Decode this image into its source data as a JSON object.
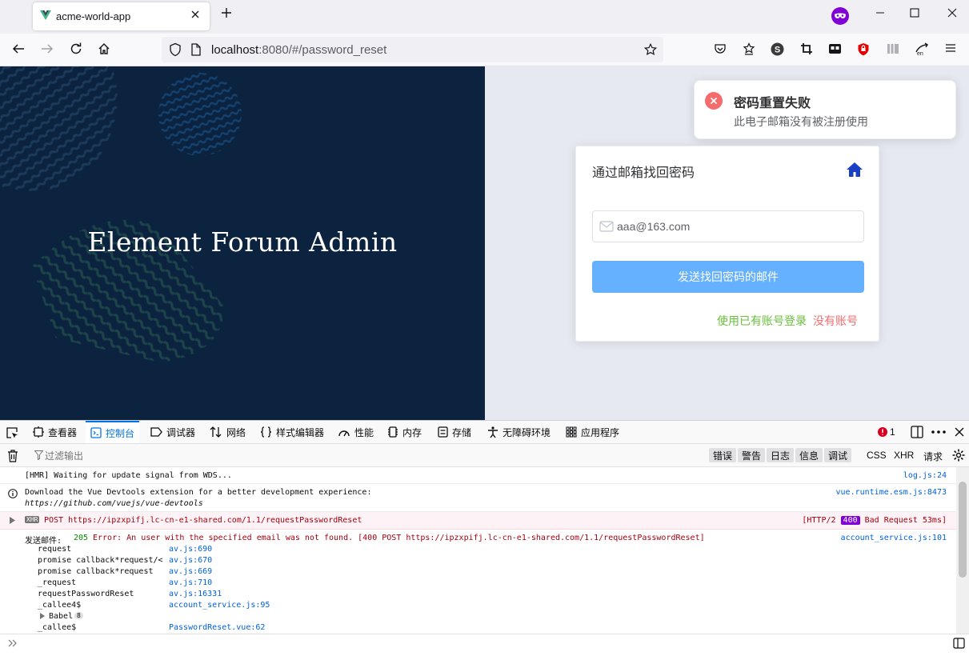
{
  "browser": {
    "tab_title": "acme-world-app",
    "url_host": "localhost",
    "url_rest": ":8080/#/password_reset"
  },
  "hero": {
    "title": "Element Forum Admin",
    "background": "#0c2340"
  },
  "card": {
    "title": "通过邮箱找回密码",
    "email_value": "aaa@163.com",
    "send_button": "发送找回密码的邮件",
    "login_link": "使用已有账号登录",
    "register_link": "没有账号"
  },
  "toast": {
    "title": "密码重置失败",
    "message": "此电子邮箱没有被注册使用"
  },
  "devtools": {
    "tabs": [
      "查看器",
      "控制台",
      "调试器",
      "网络",
      "样式编辑器",
      "性能",
      "内存",
      "存储",
      "无障碍环境",
      "应用程序"
    ],
    "active_tab": "控制台",
    "error_count": "1",
    "filter_placeholder": "过滤输出",
    "levels": [
      "错误",
      "警告",
      "日志",
      "信息",
      "调试"
    ],
    "filters": [
      "CSS",
      "XHR",
      "请求"
    ],
    "console": {
      "hmr": {
        "text": "[HMR] Waiting for update signal from WDS...",
        "src": "log.js:24"
      },
      "vue_info": {
        "line1": "Download the Vue Devtools extension for a better development experience:",
        "line2": "https://github.com/vuejs/vue-devtools",
        "src": "vue.runtime.esm.js:8473"
      },
      "xhr": {
        "badge": "XHR",
        "text": "POST https://ipzxpifj.lc-cn-e1-shared.com/1.1/requestPasswordReset",
        "status_pre": "[HTTP/2",
        "status_code": "400",
        "status_post": "Bad Request 53ms]"
      },
      "error": {
        "label": "发送邮件:",
        "code": "205",
        "text": "Error: An user with the specified email was not found. [400 POST https://ipzxpifj.lc-cn-e1-shared.com/1.1/requestPasswordReset]",
        "src": "account_service.js:101"
      },
      "trace": [
        {
          "fn": "request",
          "loc": "av.js:690"
        },
        {
          "fn": "promise callback*request/<",
          "loc": "av.js:670"
        },
        {
          "fn": "promise callback*request",
          "loc": "av.js:669"
        },
        {
          "fn": "_request",
          "loc": "av.js:710"
        },
        {
          "fn": "requestPasswordReset",
          "loc": "av.js:16331"
        },
        {
          "fn": "_callee4$",
          "loc": "account_service.js:95"
        },
        {
          "fn": "Babel",
          "loc": "8"
        },
        {
          "fn": "_callee$",
          "loc": "PasswordReset.vue:62"
        }
      ]
    }
  }
}
